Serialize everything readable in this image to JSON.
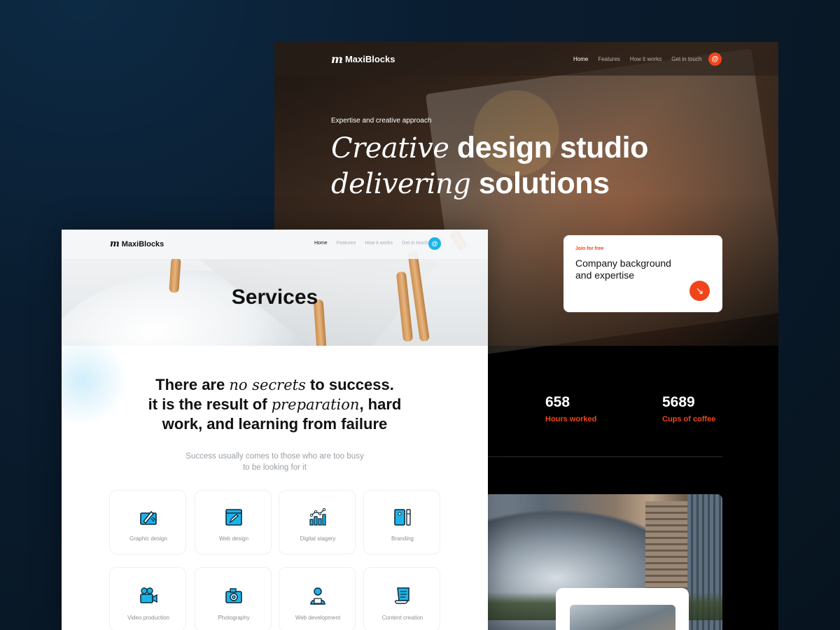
{
  "dark_page": {
    "brand": "MaxiBlocks",
    "nav": [
      "Home",
      "Features",
      "How it works",
      "Get in touch"
    ],
    "nav_active": "Home",
    "contact_icon": "at-sign-icon",
    "hero": {
      "kicker": "Expertise and creative approach",
      "title_italic_1": "Creative",
      "title_bold_1": "design studio",
      "title_italic_2": "delivering",
      "title_bold_2": "solutions"
    },
    "join_card": {
      "label": "Join for free",
      "title": "Company background and expertise",
      "arrow_icon": "arrow-down-right-icon"
    },
    "stats": [
      {
        "value": "658",
        "label": "Hours worked"
      },
      {
        "value": "5689",
        "label": "Cups of coffee"
      }
    ],
    "colors": {
      "accent": "#f0451b",
      "background": "#000000"
    }
  },
  "light_page": {
    "brand": "MaxiBlocks",
    "nav": [
      "Home",
      "Features",
      "How it works",
      "Get in touch"
    ],
    "nav_active": "Home",
    "contact_icon": "at-sign-icon",
    "page_title": "Services",
    "headline": {
      "l1_a": "There are",
      "l1_italic": "no secrets",
      "l1_b": "to success.",
      "l2_a": "it is the result of",
      "l2_italic": "preparation",
      "l2_b": ", hard",
      "l3": "work, and learning from failure"
    },
    "subline": "Success usually comes to those who are too busy to be looking for it",
    "services": [
      {
        "label": "Graphic design",
        "icon": "graphic-design-icon"
      },
      {
        "label": "Web design",
        "icon": "web-design-icon"
      },
      {
        "label": "Digital stagery",
        "icon": "bar-chart-icon"
      },
      {
        "label": "Branding",
        "icon": "branding-icon"
      },
      {
        "label": "Video production",
        "icon": "video-camera-icon"
      },
      {
        "label": "Photography",
        "icon": "camera-icon"
      },
      {
        "label": "Web development",
        "icon": "developer-icon"
      },
      {
        "label": "Content creation",
        "icon": "scroll-icon"
      }
    ],
    "colors": {
      "accent": "#1bb4ea"
    }
  }
}
